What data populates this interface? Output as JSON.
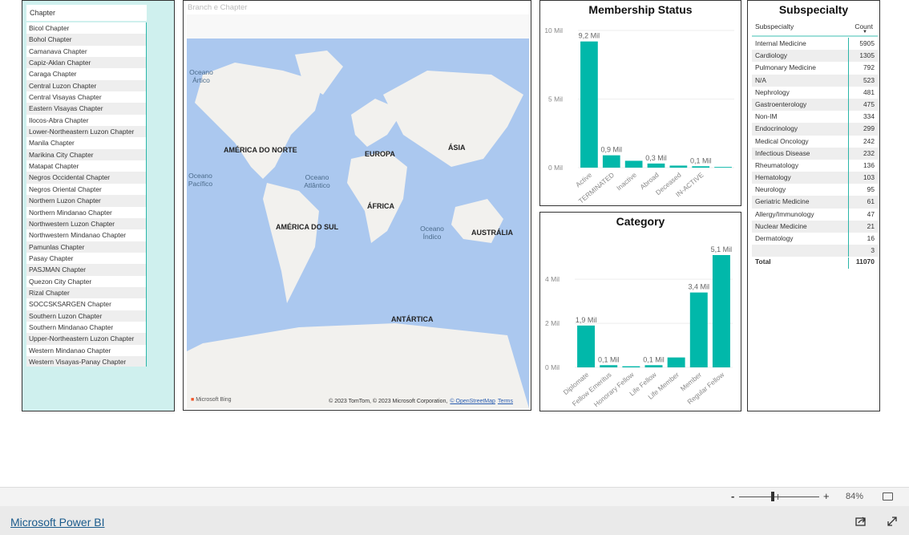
{
  "chapter_slicer": {
    "title": "Chapter",
    "items": [
      "Bicol Chapter",
      "Bohol Chapter",
      "Camanava Chapter",
      "Capiz-Aklan Chapter",
      "Caraga Chapter",
      "Central Luzon Chapter",
      "Central Visayas Chapter",
      "Eastern Visayas Chapter",
      "Ilocos-Abra Chapter",
      "Lower-Northeastern Luzon Chapter",
      "Manila Chapter",
      "Marikina City Chapter",
      "Matapat Chapter",
      "Negros Occidental Chapter",
      "Negros Oriental Chapter",
      "Northern Luzon Chapter",
      "Northern Mindanao Chapter",
      "Northwestern Luzon Chapter",
      "Northwestern Mindanao Chapter",
      "Pamunlas Chapter",
      "Pasay Chapter",
      "PASJMAN Chapter",
      "Quezon City Chapter",
      "Rizal Chapter",
      "SOCCSKSARGEN Chapter",
      "Southern Luzon Chapter",
      "Southern Mindanao Chapter",
      "Upper-Northeastern Luzon Chapter",
      "Western Mindanao Chapter",
      "Western Visayas-Panay Chapter"
    ]
  },
  "map": {
    "title": "Branch e Chapter",
    "continents": {
      "na": "AMÉRICA DO NORTE",
      "eu": "EUROPA",
      "as": "ÁSIA",
      "af": "ÁFRICA",
      "sa": "AMÉRICA DO SUL",
      "au": "AUSTRÁLIA",
      "an": "ANTÁRTICA"
    },
    "oceans": {
      "arctic": "Oceano Ártico",
      "atlantic": "Oceano Atlântico",
      "pacific": "Oceano Pacífico",
      "indian": "Oceano Índico"
    },
    "bing": "Microsoft Bing",
    "attribution": "© 2023 TomTom, © 2023 Microsoft Corporation,",
    "osm": "© OpenStreetMap",
    "terms": "Terms"
  },
  "chart_data": [
    {
      "type": "bar",
      "title": "Membership Status",
      "categories": [
        "Active",
        "TERMINATED",
        "Inactive",
        "Abroad",
        "Deceased",
        "IN-ACTIVE",
        ""
      ],
      "values": [
        9.2,
        0.9,
        0.5,
        0.3,
        0.15,
        0.1,
        0.05
      ],
      "data_labels": [
        "9,2 Mil",
        "0,9 Mil",
        "",
        "0,3 Mil",
        "",
        "0,1 Mil",
        ""
      ],
      "yticks": [
        "0 Mil",
        "5 Mil",
        "10 Mil"
      ],
      "ylim": [
        0,
        10
      ],
      "unit": "Mil",
      "color": "#01b8aa"
    },
    {
      "type": "bar",
      "title": "Category",
      "categories": [
        "Diplomate",
        "Fellow Emeritus",
        "Honorary Fellow",
        "Life Fellow",
        "Life Member",
        "Member",
        "Regular Fellow"
      ],
      "values": [
        1.9,
        0.1,
        0.05,
        0.1,
        0.45,
        3.4,
        5.1
      ],
      "data_labels": [
        "1,9 Mil",
        "0,1 Mil",
        "",
        "0,1 Mil",
        "",
        "3,4 Mil",
        "5,1 Mil"
      ],
      "yticks": [
        "0 Mil",
        "2 Mil",
        "4 Mil"
      ],
      "ylim": [
        0,
        5.5
      ],
      "unit": "Mil",
      "color": "#01b8aa"
    }
  ],
  "subspecialty": {
    "title": "Subspecialty",
    "col_name": "Subspecialty",
    "col_count": "Count",
    "rows": [
      [
        "Internal Medicine",
        "5905"
      ],
      [
        "Cardiology",
        "1305"
      ],
      [
        "Pulmonary Medicine",
        "792"
      ],
      [
        "N/A",
        "523"
      ],
      [
        "Nephrology",
        "481"
      ],
      [
        "Gastroenterology",
        "475"
      ],
      [
        "Non-IM",
        "334"
      ],
      [
        "Endocrinology",
        "299"
      ],
      [
        "Medical Oncology",
        "242"
      ],
      [
        "Infectious Disease",
        "232"
      ],
      [
        "Rheumatology",
        "136"
      ],
      [
        "Hematology",
        "103"
      ],
      [
        "Neurology",
        "95"
      ],
      [
        "Geriatric Medicine",
        "61"
      ],
      [
        "Allergy/Immunology",
        "47"
      ],
      [
        "Nuclear Medicine",
        "21"
      ],
      [
        "Dermatology",
        "16"
      ],
      [
        "",
        "3"
      ]
    ],
    "total_label": "Total",
    "total": "11070"
  },
  "zoom": {
    "minus": "-",
    "plus": "+",
    "level": "84%",
    "value": 84
  },
  "footer": {
    "link": "Microsoft Power BI"
  }
}
